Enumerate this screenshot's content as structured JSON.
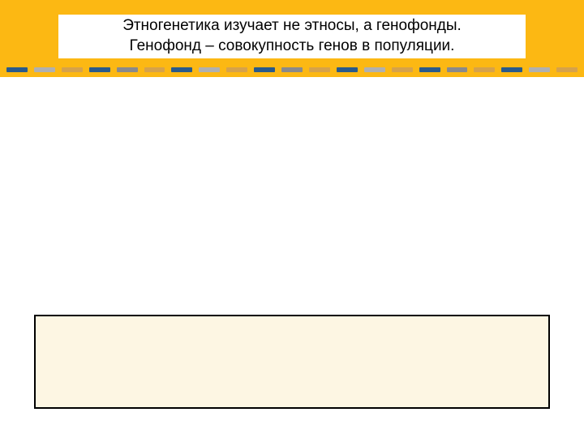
{
  "header": {
    "title_line1": "Этногенетика изучает не этносы, а генофонды.",
    "title_line2": "Генофонд – совокупность генов в популяции."
  },
  "colors": {
    "band": "#fcb813",
    "bottom_box_bg": "#fdf6e3",
    "bottom_box_border": "#000000"
  }
}
